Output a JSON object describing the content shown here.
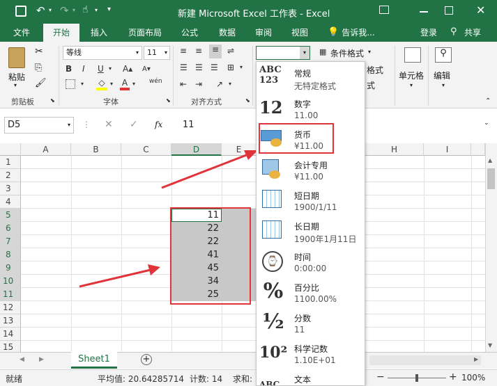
{
  "title": "新建 Microsoft Excel 工作表 - Excel",
  "tabs": [
    "文件",
    "开始",
    "插入",
    "页面布局",
    "公式",
    "数据",
    "审阅",
    "视图"
  ],
  "tell_me": "告诉我...",
  "login": "登录",
  "share": "共享",
  "ribbon": {
    "paste": "粘贴",
    "clipboard": "剪贴板",
    "font_name": "等线",
    "font_size": "11",
    "font_group": "字体",
    "align_group": "对齐方式",
    "cond_format": "条件格式",
    "cell": "单元格",
    "edit": "编辑",
    "cut_frag1": "格式",
    "cut_frag2": "式",
    "wen": "wén",
    "bold": "B",
    "italic": "I",
    "underline": "U",
    "font_color": "A"
  },
  "formula": {
    "name_box": "D5",
    "value": "11",
    "fx": "fx"
  },
  "columns": [
    "A",
    "B",
    "C",
    "D",
    "E",
    "H",
    "I"
  ],
  "rows": [
    "1",
    "2",
    "3",
    "4",
    "5",
    "6",
    "7",
    "8",
    "9",
    "10",
    "11",
    "12",
    "13",
    "14",
    "15"
  ],
  "values": [
    "11",
    "22",
    "22",
    "41",
    "45",
    "34",
    "25"
  ],
  "sheet_tab": "Sheet1",
  "status": {
    "ready": "就绪",
    "average": "平均值: 20.64285714",
    "count": "计数: 14",
    "sum": "求和:",
    "zoom": "100%"
  },
  "number_formats": [
    {
      "name": "常规",
      "sample": "无特定格式",
      "icon": "ABC 123"
    },
    {
      "name": "数字",
      "sample": "11.00",
      "icon": "12"
    },
    {
      "name": "货币",
      "sample": "¥11.00",
      "icon": "currency"
    },
    {
      "name": "会计专用",
      "sample": "¥11.00",
      "icon": "accounting"
    },
    {
      "name": "短日期",
      "sample": "1900/1/11",
      "icon": "calendar"
    },
    {
      "name": "长日期",
      "sample": "1900年1月11日",
      "icon": "calendar"
    },
    {
      "name": "时间",
      "sample": "0:00:00",
      "icon": "clock"
    },
    {
      "name": "百分比",
      "sample": "1100.00%",
      "icon": "%"
    },
    {
      "name": "分数",
      "sample": "11",
      "icon": "½"
    },
    {
      "name": "科学记数",
      "sample": "1.10E+01",
      "icon": "10²"
    },
    {
      "name": "文本",
      "sample": "",
      "icon": "ABC"
    }
  ],
  "colors": {
    "excel_green": "#217346",
    "highlight": "#e0343a",
    "selected_fill": "#c8c8c8"
  }
}
